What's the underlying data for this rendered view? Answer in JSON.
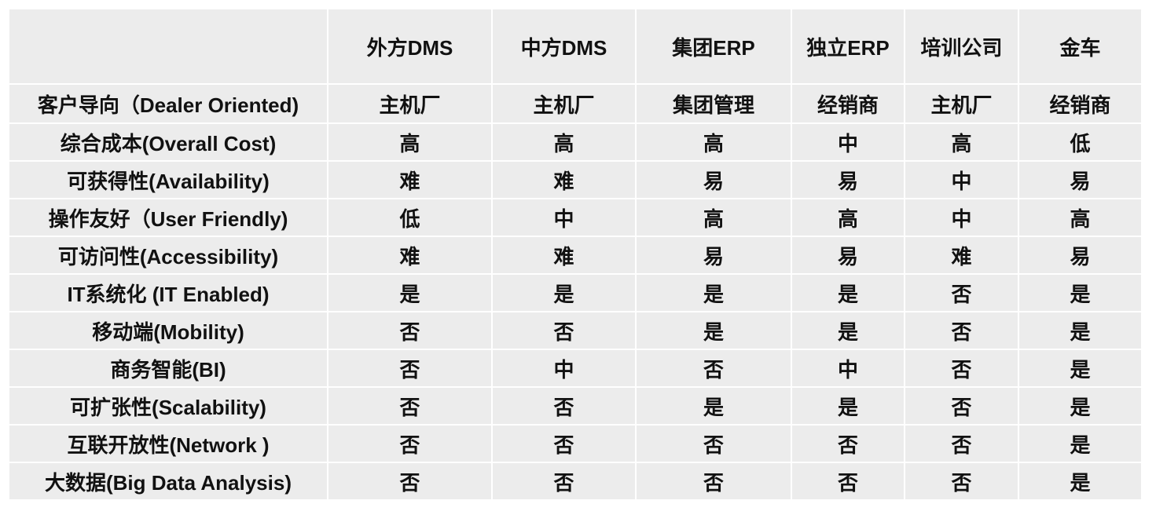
{
  "table": {
    "corner": "",
    "columns": [
      "外方DMS",
      "中方DMS",
      "集团ERP",
      "独立ERP",
      "培训公司",
      "金车"
    ],
    "rows": [
      {
        "label": "客户导向（Dealer Oriented)",
        "values": [
          "主机厂",
          "主机厂",
          "集团管理",
          "经销商",
          "主机厂",
          "经销商"
        ]
      },
      {
        "label": "综合成本(Overall Cost)",
        "values": [
          "高",
          "高",
          "高",
          "中",
          "高",
          "低"
        ]
      },
      {
        "label": "可获得性(Availability)",
        "values": [
          "难",
          "难",
          "易",
          "易",
          "中",
          "易"
        ]
      },
      {
        "label": "操作友好（User Friendly)",
        "values": [
          "低",
          "中",
          "高",
          "高",
          "中",
          "高"
        ]
      },
      {
        "label": "可访问性(Accessibility)",
        "values": [
          "难",
          "难",
          "易",
          "易",
          "难",
          "易"
        ]
      },
      {
        "label": "IT系统化 (IT Enabled)",
        "values": [
          "是",
          "是",
          "是",
          "是",
          "否",
          "是"
        ]
      },
      {
        "label": "移动端(Mobility)",
        "values": [
          "否",
          "否",
          "是",
          "是",
          "否",
          "是"
        ]
      },
      {
        "label": "商务智能(BI)",
        "values": [
          "否",
          "中",
          "否",
          "中",
          "否",
          "是"
        ]
      },
      {
        "label": "可扩张性(Scalability)",
        "values": [
          "否",
          "否",
          "是",
          "是",
          "否",
          "是"
        ]
      },
      {
        "label": "互联开放性(Network )",
        "values": [
          "否",
          "否",
          "否",
          "否",
          "否",
          "是"
        ]
      },
      {
        "label": "大数据(Big Data Analysis)",
        "values": [
          "否",
          "否",
          "否",
          "否",
          "否",
          "是"
        ]
      }
    ]
  },
  "colors": {
    "cell_background": "#ececec",
    "grid_lines": "#ffffff",
    "text": "#111111"
  }
}
